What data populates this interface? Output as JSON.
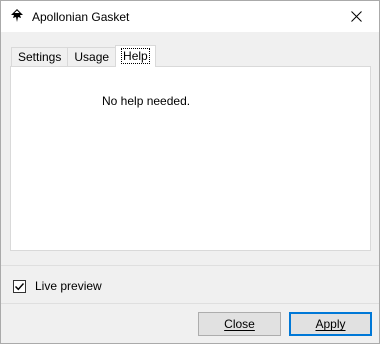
{
  "window": {
    "title": "Apollonian Gasket",
    "app_icon": "inkscape-icon",
    "close_icon": "close-icon"
  },
  "tabs": [
    {
      "label": "Settings",
      "active": false
    },
    {
      "label": "Usage",
      "active": false
    },
    {
      "label": "Help",
      "active": true
    }
  ],
  "help_panel": {
    "text": "No help needed."
  },
  "live_preview": {
    "label": "Live preview",
    "checked": true
  },
  "buttons": {
    "close_label": "Close",
    "apply_label": "Apply"
  },
  "colors": {
    "accent": "#0078d7",
    "window_bg": "#f0f0f0"
  }
}
